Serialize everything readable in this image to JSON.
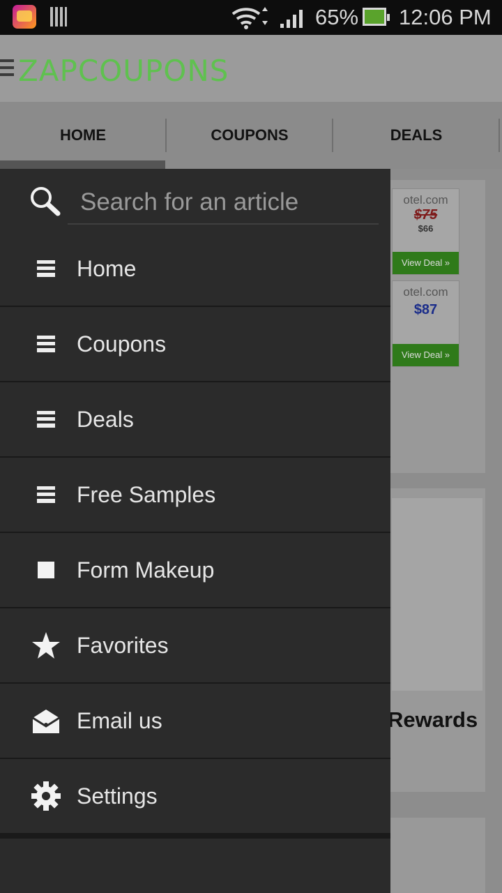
{
  "status_bar": {
    "battery": "65%",
    "time": "12:06 PM"
  },
  "header": {
    "logo": "ZAPCOUPONS"
  },
  "tabs": [
    {
      "label": "HOME"
    },
    {
      "label": "COUPONS"
    },
    {
      "label": "DEALS"
    }
  ],
  "background": {
    "deal1": {
      "site": "otel.com",
      "old_price": "$75",
      "new_price": "$66",
      "button": "View Deal »"
    },
    "deal2": {
      "site": "otel.com",
      "price": "$87",
      "button": "View Deal »"
    },
    "rewards_text": "Rewards"
  },
  "drawer": {
    "search": {
      "placeholder": "Search for an article"
    },
    "items": [
      {
        "label": "Home",
        "icon": "list-icon"
      },
      {
        "label": "Coupons",
        "icon": "list-icon"
      },
      {
        "label": "Deals",
        "icon": "list-icon"
      },
      {
        "label": "Free Samples",
        "icon": "list-icon"
      },
      {
        "label": "Form Makeup",
        "icon": "square-icon"
      },
      {
        "label": "Favorites",
        "icon": "star-icon"
      },
      {
        "label": "Email us",
        "icon": "envelope-icon"
      },
      {
        "label": "Settings",
        "icon": "gear-icon"
      }
    ]
  },
  "colors": {
    "drawer_bg": "#2b2b2b",
    "logo_green": "#5fc14f",
    "deal_button": "#2f7a1a"
  }
}
